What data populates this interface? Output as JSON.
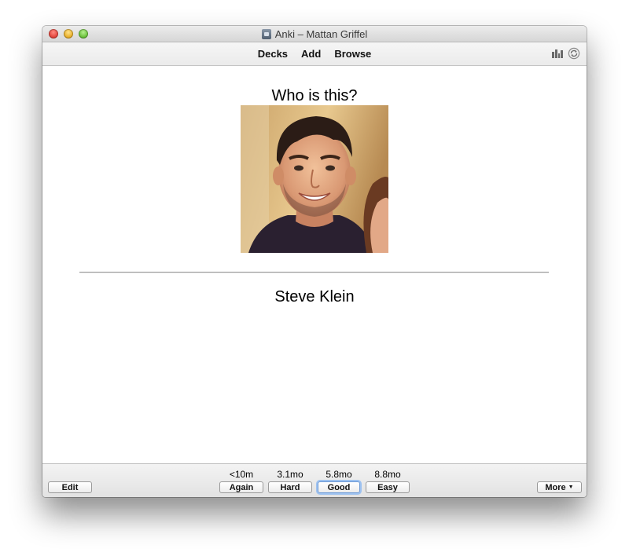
{
  "window": {
    "title": "Anki – Mattan Griffel"
  },
  "toolbar": {
    "links": [
      "Decks",
      "Add",
      "Browse"
    ],
    "icons": [
      "stats-icon",
      "sync-icon"
    ]
  },
  "card": {
    "question": "Who is this?",
    "answer": "Steve Klein",
    "image": "photo of a smiling man"
  },
  "bottom": {
    "edit_label": "Edit",
    "more_label": "More",
    "answers": [
      {
        "interval": "<10m",
        "label": "Again"
      },
      {
        "interval": "3.1mo",
        "label": "Hard"
      },
      {
        "interval": "5.8mo",
        "label": "Good"
      },
      {
        "interval": "8.8mo",
        "label": "Easy"
      }
    ],
    "default_answer": "Good"
  }
}
